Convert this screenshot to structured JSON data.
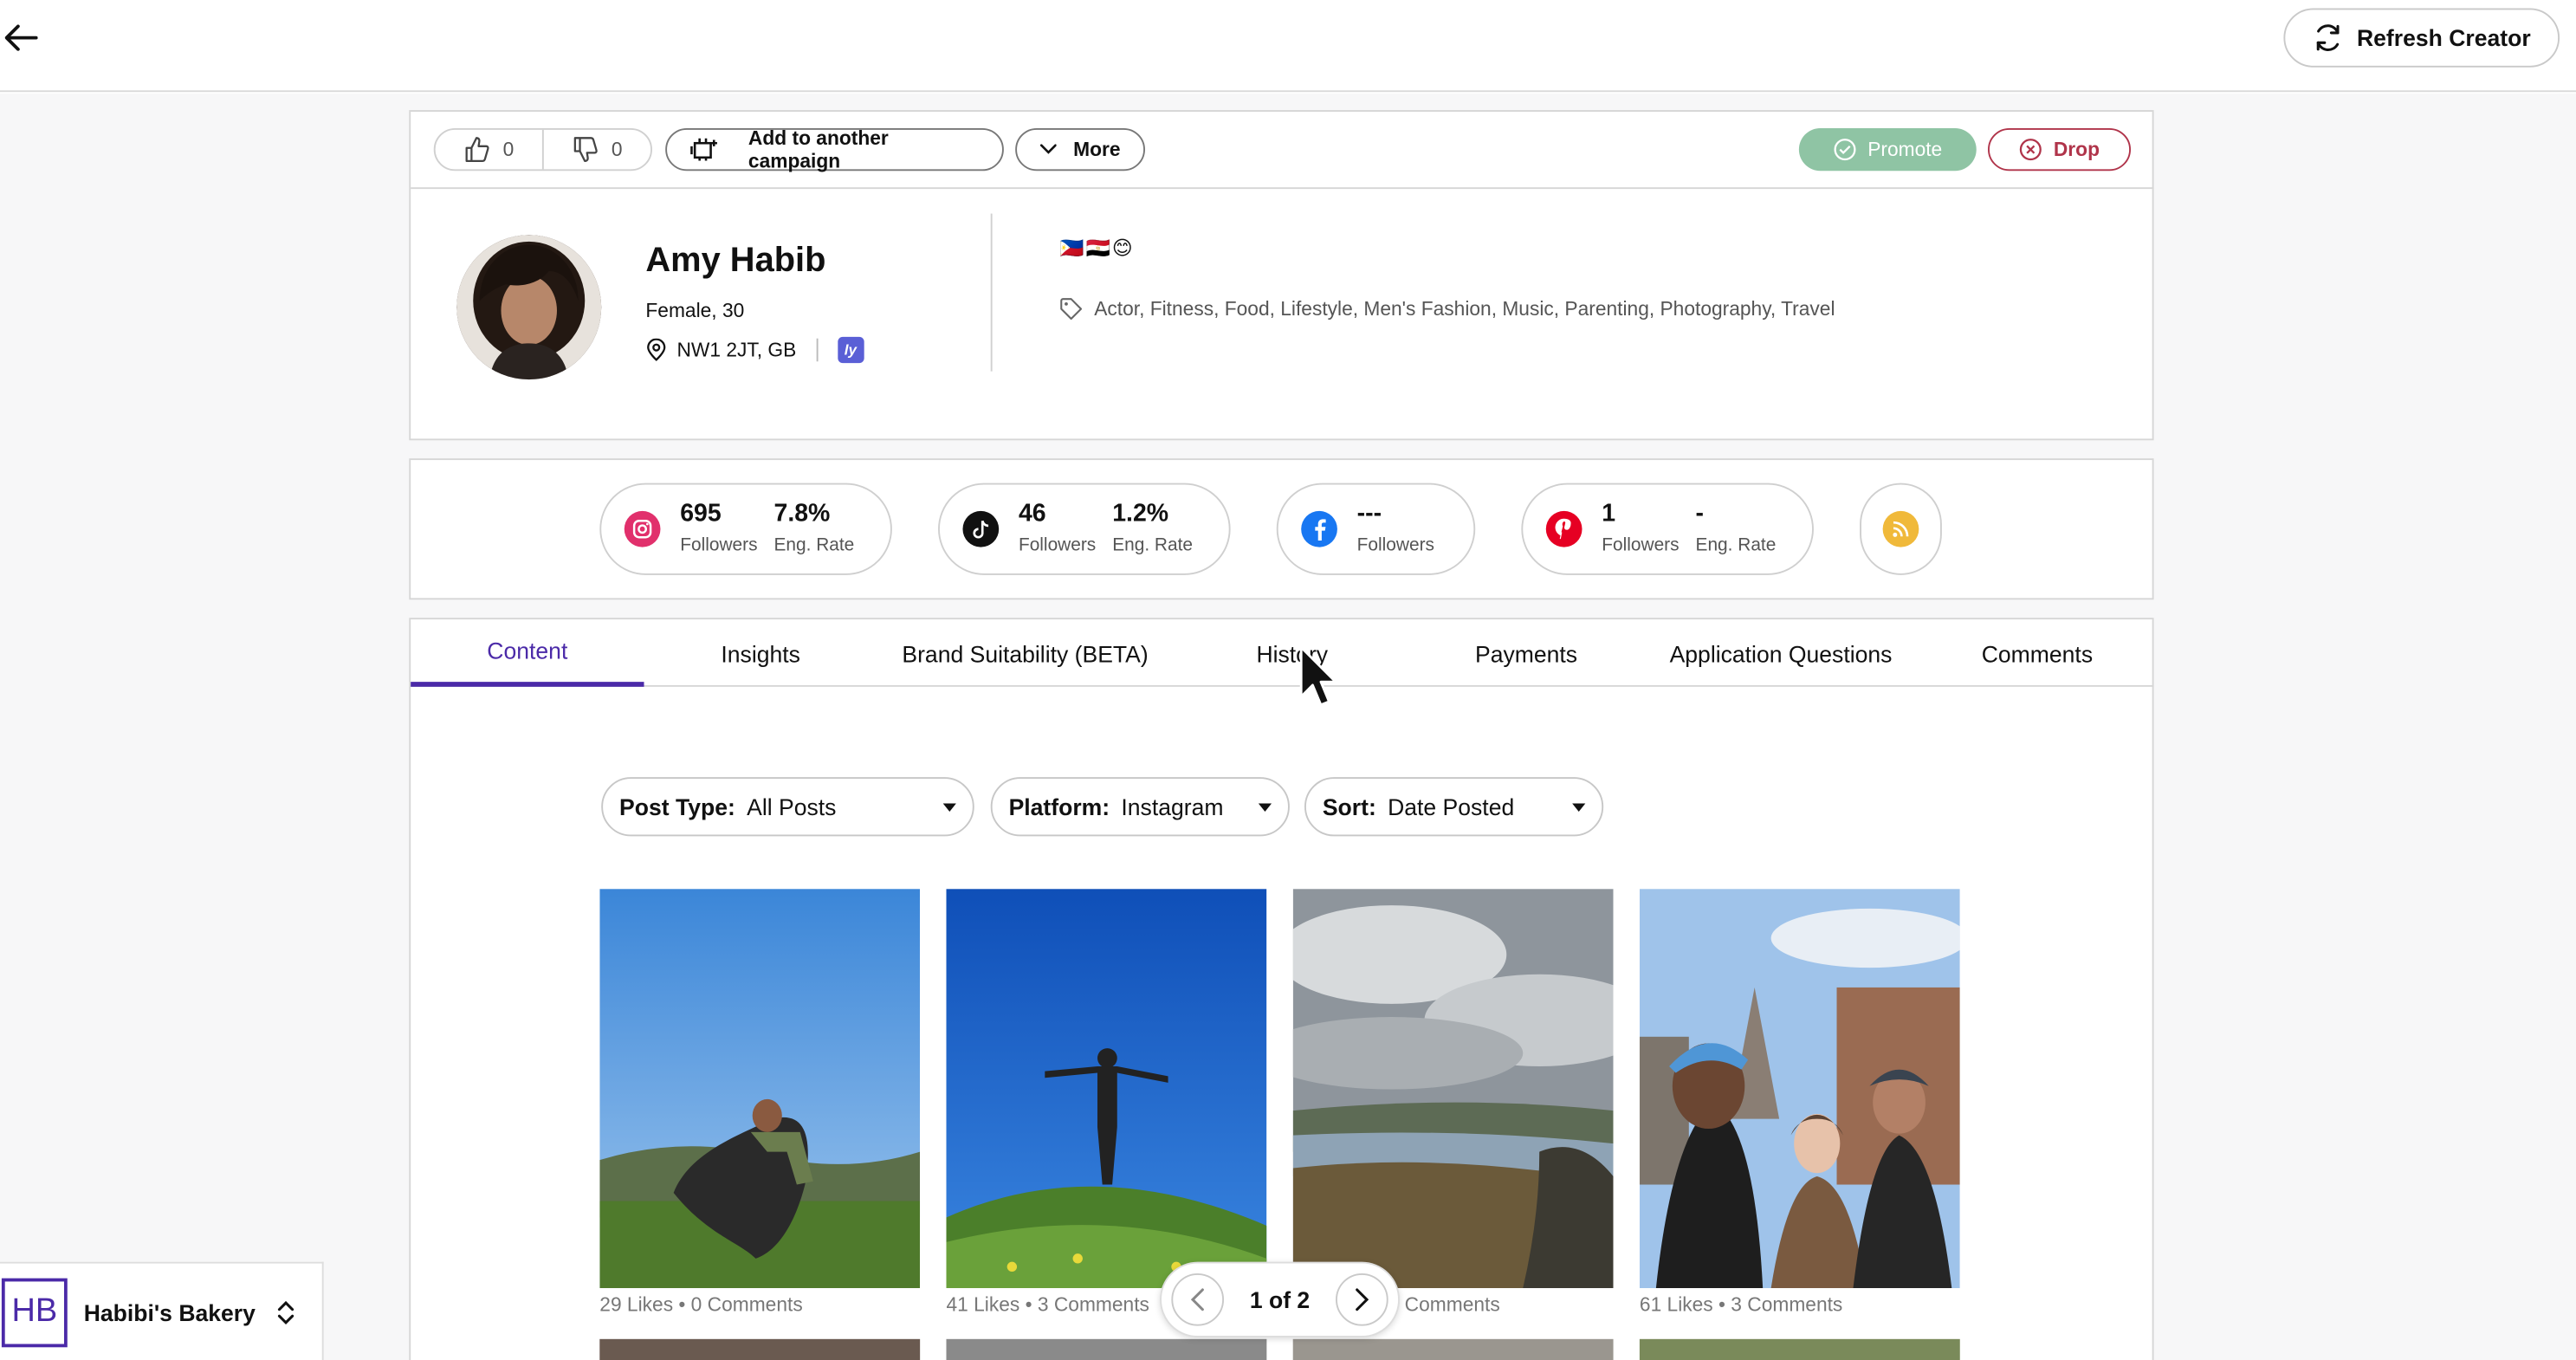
{
  "header": {
    "refresh_label": "Refresh Creator"
  },
  "actions": {
    "likes": "0",
    "dislikes": "0",
    "add_campaign_label": "Add to another campaign",
    "more_label": "More",
    "promote_label": "Promote",
    "drop_label": "Drop"
  },
  "profile": {
    "name": "Amy Habib",
    "gender_age": "Female, 30",
    "location": "NW1 2JT, GB",
    "badge": "ly",
    "flags": [
      "🇵🇭",
      "🇪🇬",
      "😊"
    ],
    "tags": "Actor, Fitness, Food, Lifestyle, Men's Fashion, Music, Parenting, Photography, Travel"
  },
  "stats": {
    "instagram": {
      "followers": "695",
      "followers_label": "Followers",
      "eng_rate": "7.8%",
      "eng_label": "Eng. Rate"
    },
    "tiktok": {
      "followers": "46",
      "followers_label": "Followers",
      "eng_rate": "1.2%",
      "eng_label": "Eng. Rate"
    },
    "facebook": {
      "followers": "---",
      "followers_label": "Followers"
    },
    "pinterest": {
      "followers": "1",
      "followers_label": "Followers",
      "eng_rate": "-",
      "eng_label": "Eng. Rate"
    }
  },
  "tabs": [
    "Content",
    "Insights",
    "Brand Suitability (BETA)",
    "History",
    "Payments",
    "Application Questions",
    "Comments"
  ],
  "filters": {
    "post_type_label": "Post Type:",
    "post_type_value": "All Posts",
    "platform_label": "Platform:",
    "platform_value": "Instagram",
    "sort_label": "Sort:",
    "sort_value": "Date Posted"
  },
  "posts": [
    {
      "meta": "29 Likes • 0 Comments"
    },
    {
      "meta": "41 Likes • 3 Comments"
    },
    {
      "meta": "Comments"
    },
    {
      "meta": "61 Likes • 3 Comments"
    }
  ],
  "pager": {
    "text": "1 of 2"
  },
  "workspace": {
    "initials": "HB",
    "name": "Habibi's Bakery"
  },
  "colors": {
    "accent": "#4b2aa8",
    "promote": "#8fc4a4",
    "drop": "#b0344a"
  }
}
